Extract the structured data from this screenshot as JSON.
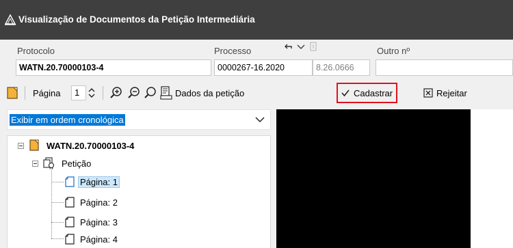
{
  "window": {
    "title": "Visualização de Documentos da Petição Intermediária"
  },
  "header": {
    "protocolo_label": "Protocolo",
    "protocolo_value": "WATN.20.70000103-4",
    "processo_label": "Processo",
    "processo_value": "0000267-16.2020",
    "processo_suffix": "8.26.0666",
    "outro_label": "Outro nº",
    "outro_value": ""
  },
  "toolbar": {
    "page_label": "Página",
    "page_value": "1",
    "dados_label": "Dados da petição",
    "cadastrar_label": "Cadastrar",
    "rejeitar_label": "Rejeitar"
  },
  "order_select": {
    "selected": "Exibir em ordem cronológica"
  },
  "tree": {
    "root": "WATN.20.70000103-4",
    "child": "Petição",
    "pages": [
      "Página: 1",
      "Página: 2",
      "Página: 3",
      "Página: 4"
    ]
  },
  "colors": {
    "titlebar": "#3f3f3f",
    "highlight_border": "#e0121b",
    "selection": "#0078d7",
    "folder_orange": "#f5a623"
  }
}
